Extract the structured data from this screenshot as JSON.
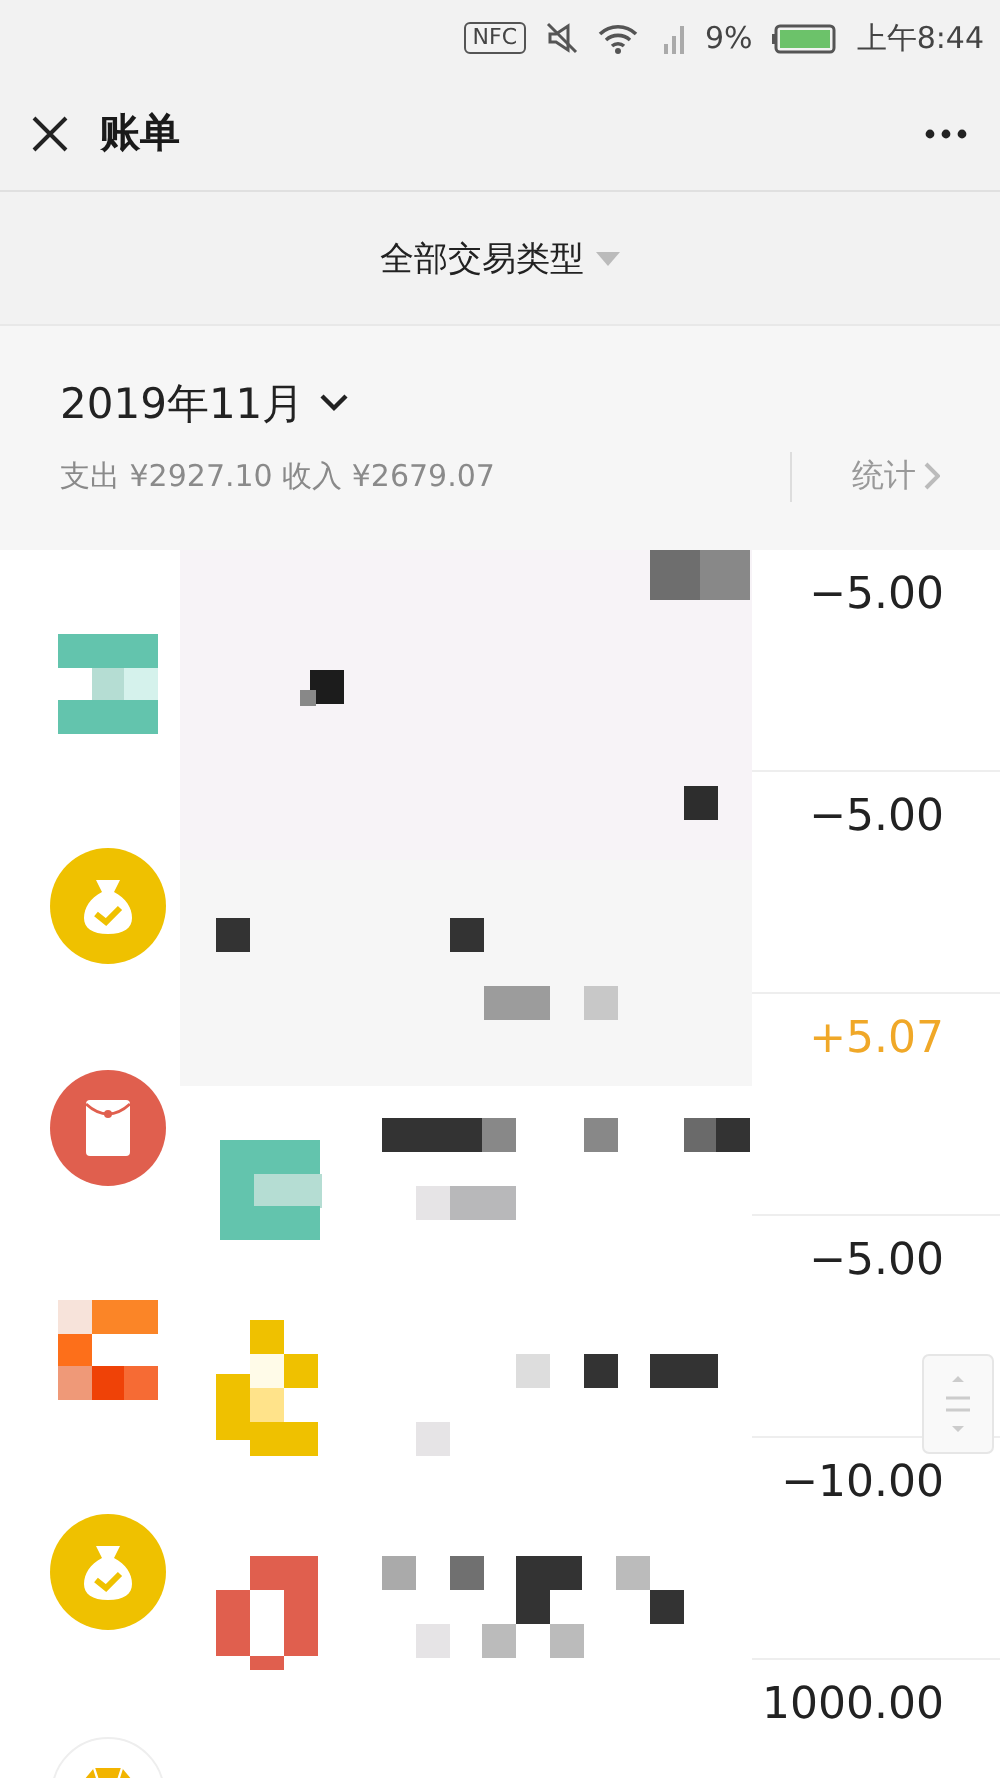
{
  "status_bar": {
    "nfc_label": "NFC",
    "battery_percent": "9%",
    "time": "上午8:44"
  },
  "header": {
    "title": "账单"
  },
  "filter": {
    "label": "全部交易类型"
  },
  "month": {
    "label": "2019年11月",
    "summary": "支出 ¥2927.10 收入 ¥2679.07",
    "stats_link": "统计"
  },
  "transactions": [
    {
      "kind": "blocks",
      "amount": "−5.00",
      "income": false
    },
    {
      "kind": "bag",
      "amount": "−5.00",
      "income": false
    },
    {
      "kind": "envelope",
      "amount": "+5.07",
      "income": true
    },
    {
      "kind": "tiles",
      "amount": "−5.00",
      "income": false
    },
    {
      "kind": "bag",
      "amount": "−10.00",
      "income": false
    },
    {
      "kind": "diamond",
      "amount": "1000.00",
      "income": false
    }
  ]
}
